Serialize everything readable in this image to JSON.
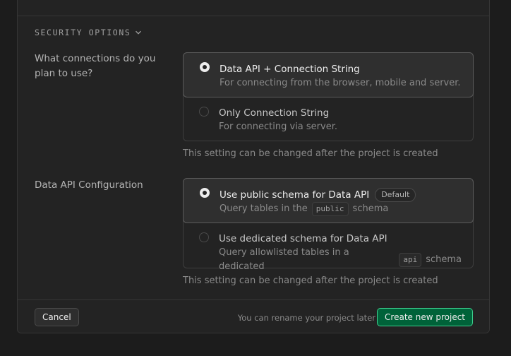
{
  "security": {
    "section_label": "SECURITY OPTIONS",
    "connections": {
      "label": "What connections do you plan to use?",
      "options": [
        {
          "title": "Data API + Connection String",
          "description": "For connecting from the browser, mobile and server.",
          "selected": true
        },
        {
          "title": "Only Connection String",
          "description": "For connecting via server.",
          "selected": false
        }
      ],
      "hint": "This setting can be changed after the project is created"
    },
    "data_api": {
      "label": "Data API Configuration",
      "options": [
        {
          "title": "Use public schema for Data API",
          "badge": "Default",
          "description_before": "Query tables in the",
          "code": "public",
          "description_after": "schema",
          "selected": true
        },
        {
          "title": "Use dedicated schema for Data API",
          "description_before": "Query allowlisted tables in a dedicated",
          "code": "api",
          "description_after": "schema",
          "selected": false
        }
      ],
      "hint": "This setting can be changed after the project is created"
    }
  },
  "footer": {
    "cancel_label": "Cancel",
    "rename_note": "You can rename your project later",
    "create_label": "Create new project"
  },
  "colors": {
    "background": "#1c1c1c",
    "panel": "#232323",
    "brand_green": "#006239",
    "brand_green_border": "#3ecf8e"
  }
}
